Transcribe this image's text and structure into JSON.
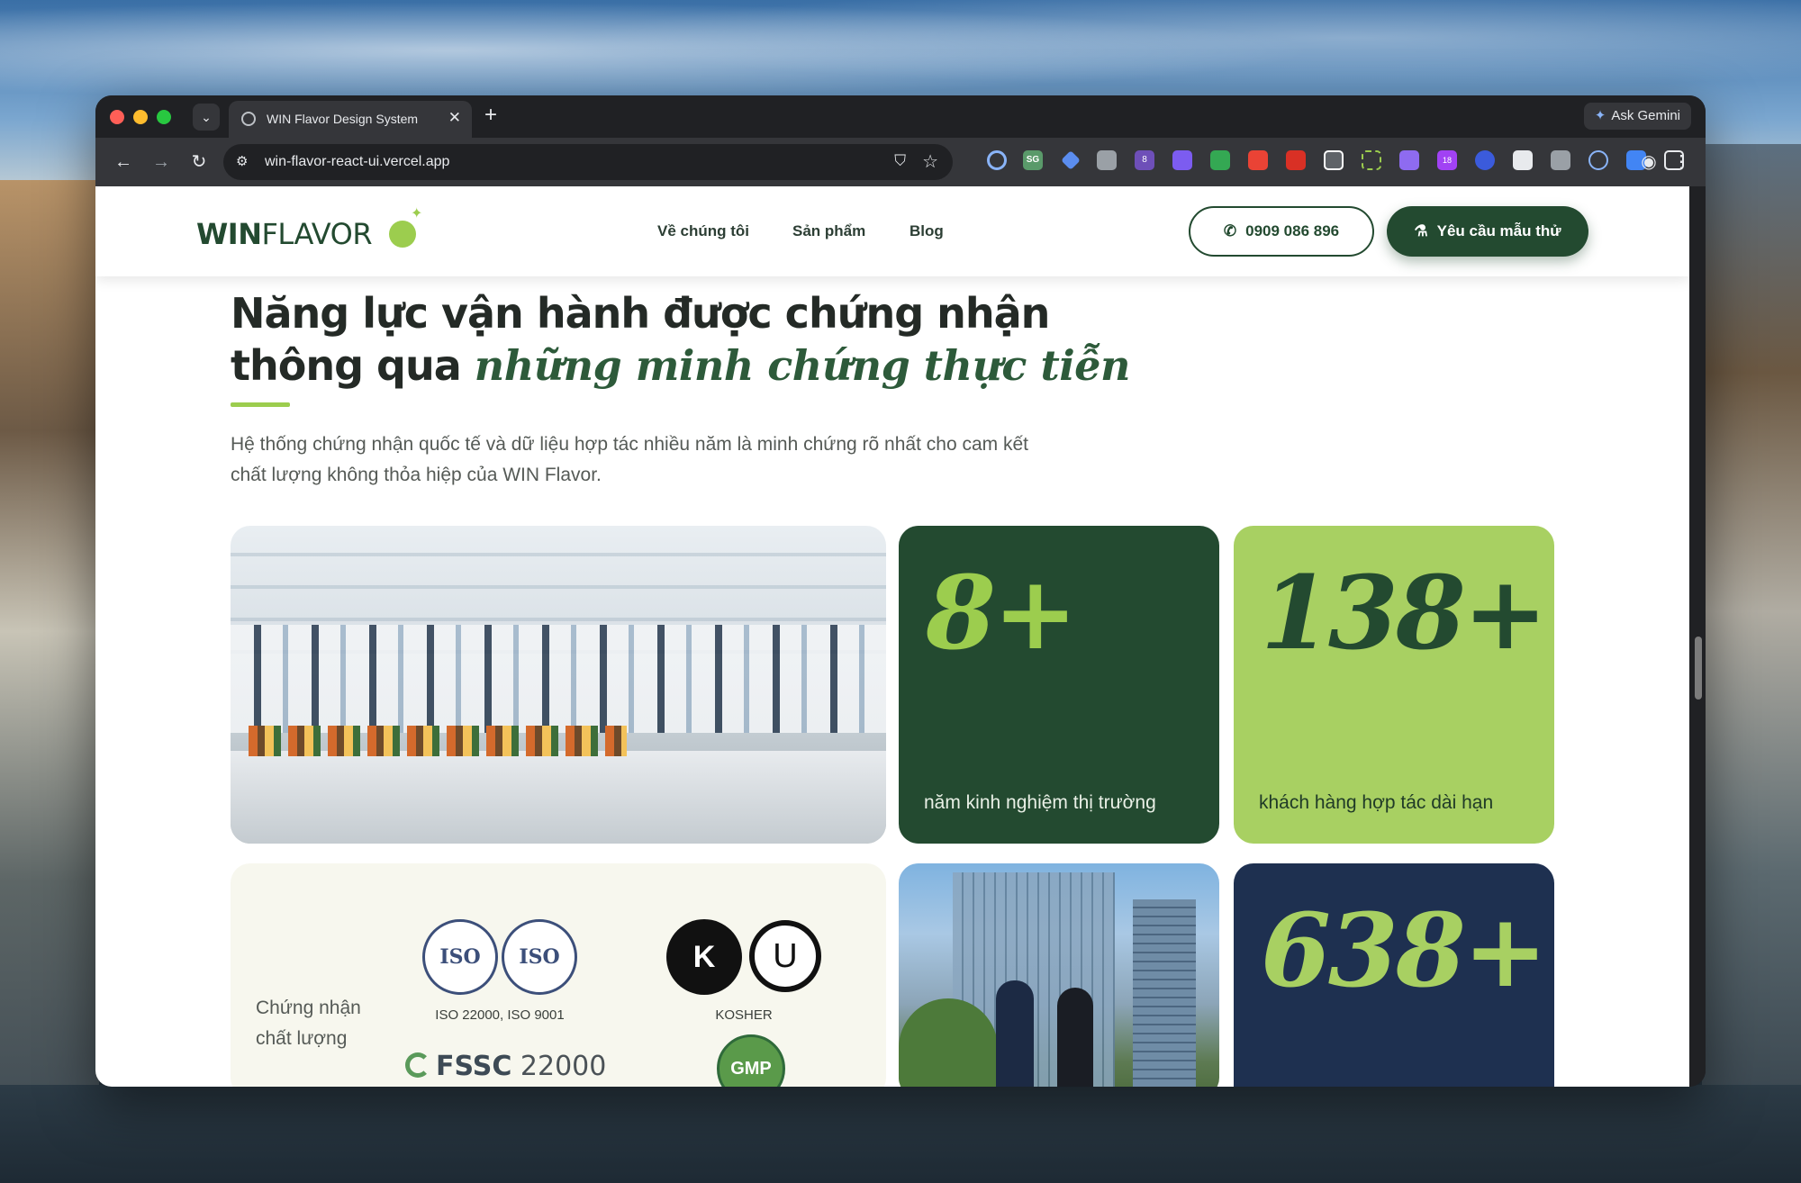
{
  "browser": {
    "tab_title": "WIN Flavor Design System",
    "url": "win-flavor-react-ui.vercel.app",
    "gemini_label": "Ask Gemini",
    "extension_badges": [
      "SG",
      "8",
      "18"
    ]
  },
  "site": {
    "logo_bold": "WIN",
    "logo_light": "FLAVOR",
    "nav": [
      "Về chúng tôi",
      "Sản phẩm",
      "Blog"
    ],
    "phone": "0909 086 896",
    "cta": "Yêu cầu mẫu thử"
  },
  "section": {
    "heading_line1": "Năng lực vận hành được chứng nhận",
    "heading_line2_plain": "thông qua",
    "heading_line2_accent": "những minh chứng thực tiễn",
    "intro": "Hệ thống chứng nhận quốc tế và dữ liệu hợp tác nhiều năm là minh chứng rõ nhất cho cam kết chất lượng không thỏa hiệp của WIN Flavor."
  },
  "stats": [
    {
      "value": "8+",
      "label": "năm kinh nghiệm thị trường"
    },
    {
      "value": "138+",
      "label": "khách hàng hợp tác dài hạn"
    },
    {
      "value": "638+",
      "label": ""
    }
  ],
  "certifications": {
    "title": "Chứng nhận chất lượng",
    "iso_badge_text": "ISO",
    "iso_caption": "ISO 22000, ISO 9001",
    "kosher_k": "K",
    "kosher_u": "U",
    "kosher_caption": "KOSHER",
    "fssc_bold": "FSSC",
    "fssc_number": "22000",
    "gmp": "GMP"
  },
  "colors": {
    "brand_green": "#234a30",
    "lime": "#a8d062",
    "navy": "#1e3050",
    "cream": "#f7f7ee"
  }
}
